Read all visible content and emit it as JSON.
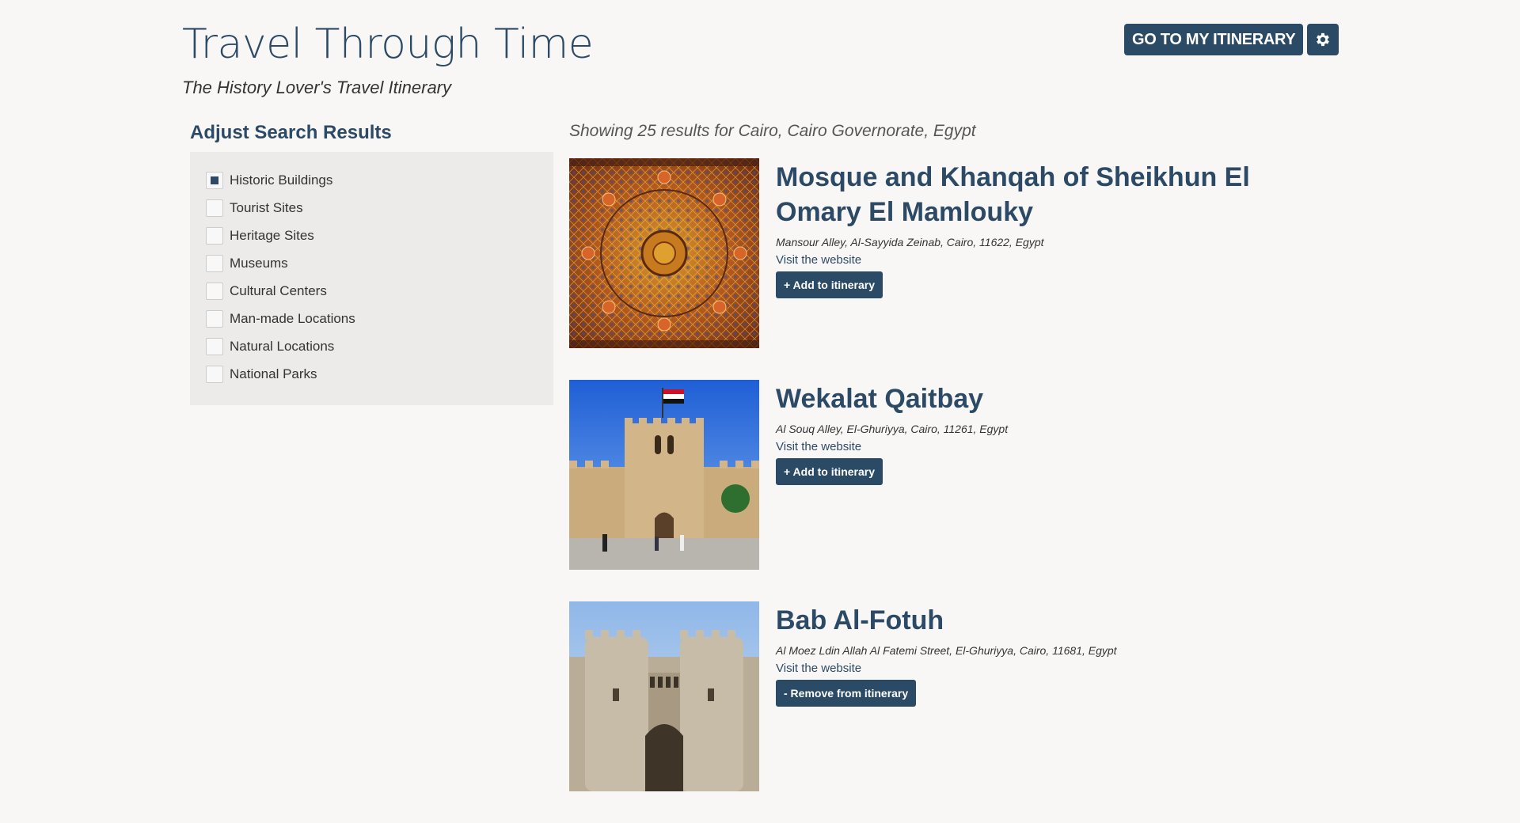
{
  "header": {
    "title": "Travel Through Time",
    "subtitle": "The History Lover's Travel Itinerary"
  },
  "top_actions": {
    "itinerary_label": "GO TO MY ITINERARY",
    "settings_icon": "gear-icon"
  },
  "sidebar": {
    "heading": "Adjust Search Results",
    "filters": [
      {
        "label": "Historic Buildings",
        "checked": true
      },
      {
        "label": "Tourist Sites",
        "checked": false
      },
      {
        "label": "Heritage Sites",
        "checked": false
      },
      {
        "label": "Museums",
        "checked": false
      },
      {
        "label": "Cultural Centers",
        "checked": false
      },
      {
        "label": "Man-made Locations",
        "checked": false
      },
      {
        "label": "Natural Locations",
        "checked": false
      },
      {
        "label": "National Parks",
        "checked": false
      }
    ]
  },
  "results": {
    "summary": "Showing 25 results for Cairo, Cairo Governorate, Egypt",
    "items": [
      {
        "name": "Mosque and Khanqah of Sheikhun El Omary El Mamlouky",
        "address": "Mansour Alley, Al-Sayyida Zeinab, Cairo, 11622, Egypt",
        "website_label": "Visit the website",
        "action_label": "+ Add to itinerary"
      },
      {
        "name": "Wekalat Qaitbay",
        "address": "Al Souq Alley, El-Ghuriyya, Cairo, 11261, Egypt",
        "website_label": "Visit the website",
        "action_label": "+ Add to itinerary"
      },
      {
        "name": "Bab Al-Fotuh",
        "address": "Al Moez Ldin Allah Al Fatemi Street, El-Ghuriyya, Cairo, 11681, Egypt",
        "website_label": "Visit the website",
        "action_label": "- Remove from itinerary"
      }
    ]
  },
  "colors": {
    "accent": "#2b4a66",
    "background": "#f8f7f6",
    "panel": "#ecebe9"
  }
}
